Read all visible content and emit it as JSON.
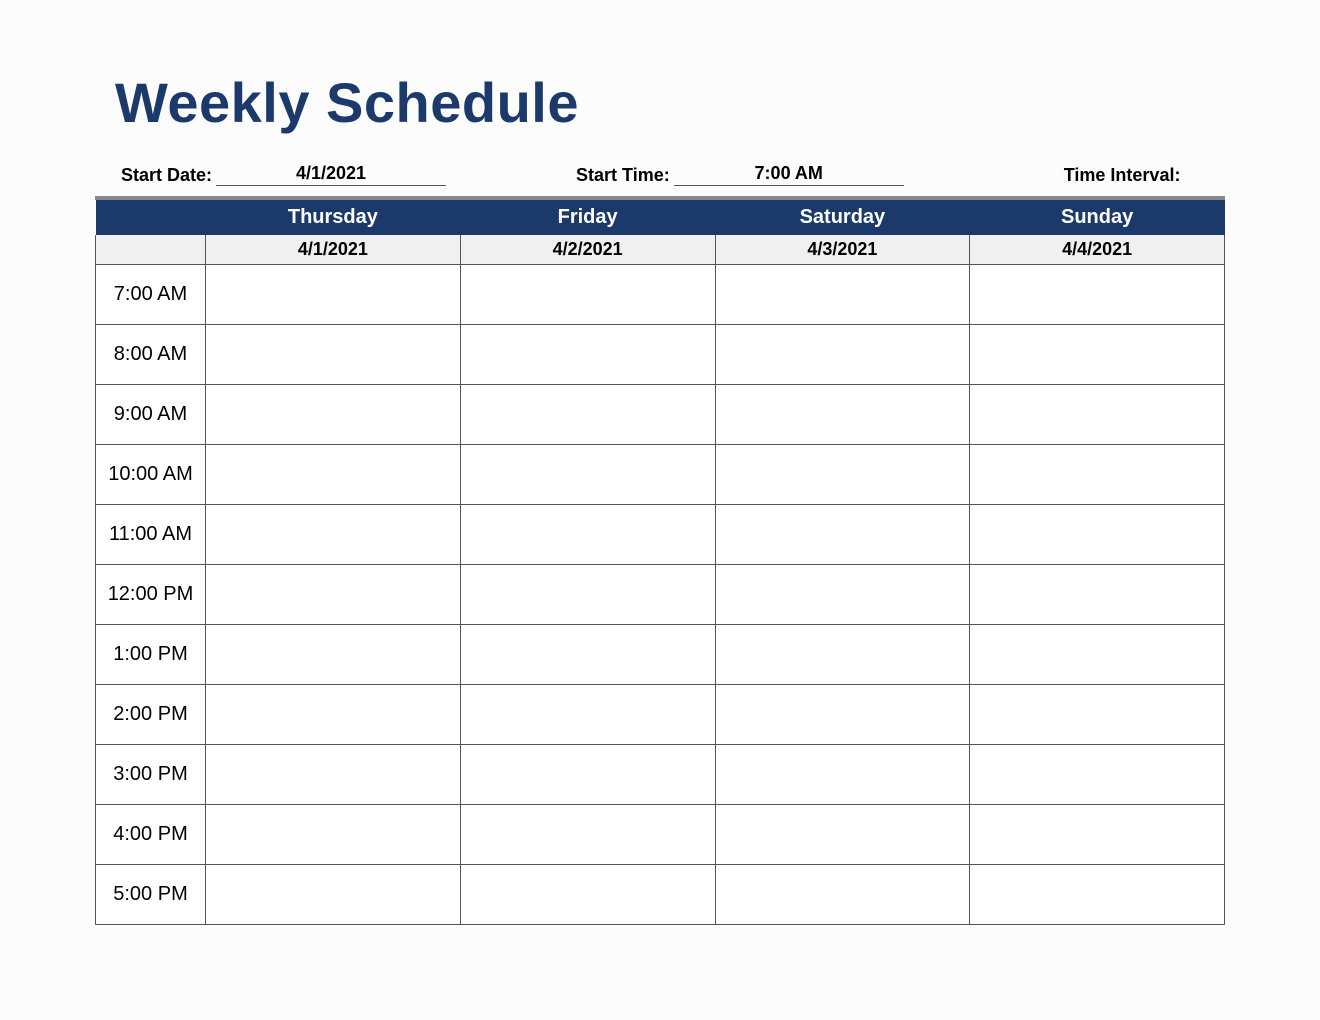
{
  "title": "Weekly Schedule",
  "meta": {
    "start_date_label": "Start Date:",
    "start_date_value": "4/1/2021",
    "start_time_label": "Start Time:",
    "start_time_value": "7:00 AM",
    "time_interval_label": "Time Interval:"
  },
  "days": [
    {
      "name": "Thursday",
      "date": "4/1/2021"
    },
    {
      "name": "Friday",
      "date": "4/2/2021"
    },
    {
      "name": "Saturday",
      "date": "4/3/2021"
    },
    {
      "name": "Sunday",
      "date": "4/4/2021"
    }
  ],
  "times": [
    "7:00 AM",
    "8:00 AM",
    "9:00 AM",
    "10:00 AM",
    "11:00 AM",
    "12:00 PM",
    "1:00 PM",
    "2:00 PM",
    "3:00 PM",
    "4:00 PM",
    "5:00 PM"
  ]
}
